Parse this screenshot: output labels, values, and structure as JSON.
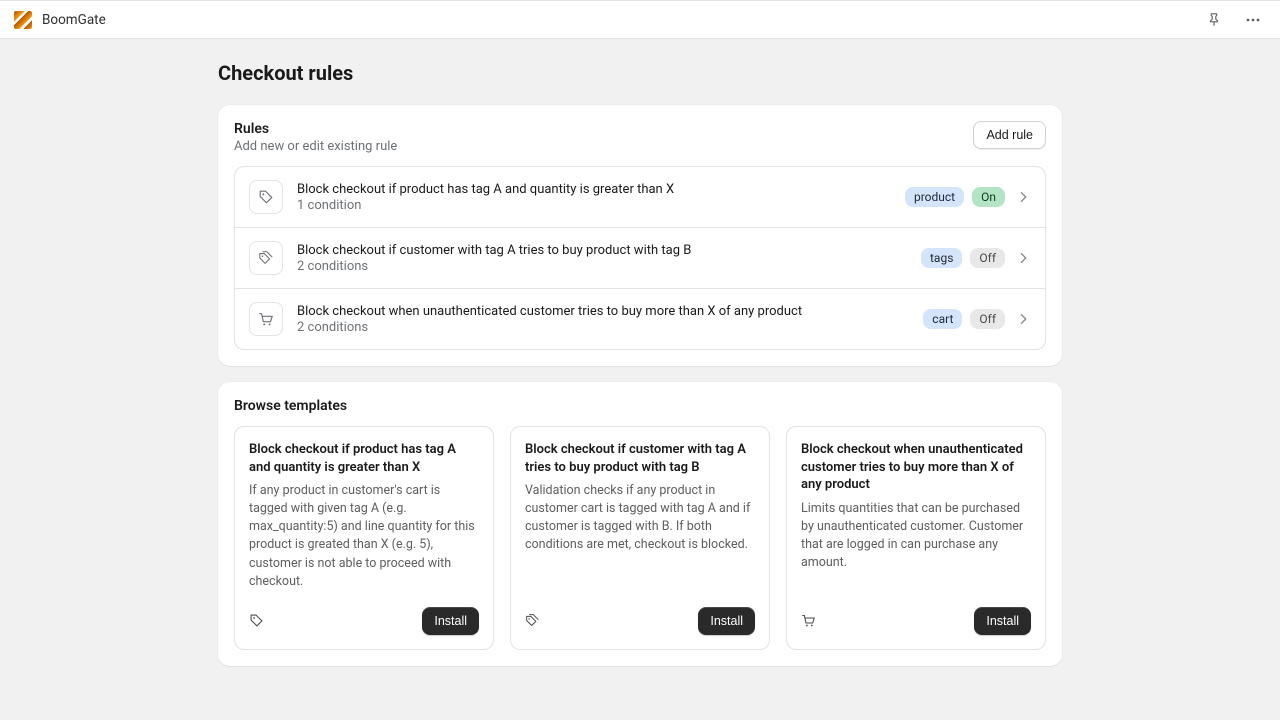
{
  "app": {
    "name": "BoomGate"
  },
  "page": {
    "title": "Checkout rules"
  },
  "rules_section": {
    "title": "Rules",
    "subtitle": "Add new or edit existing rule",
    "add_button": "Add rule",
    "rules": [
      {
        "icon": "tag-icon",
        "title": "Block checkout if product has tag A and quantity is greater than X",
        "meta": "1 condition",
        "type_badge": "product",
        "status_badge": "On",
        "status_on": true
      },
      {
        "icon": "tags-icon",
        "title": "Block checkout if customer with tag A tries to buy product with tag B",
        "meta": "2 conditions",
        "type_badge": "tags",
        "status_badge": "Off",
        "status_on": false
      },
      {
        "icon": "cart-icon",
        "title": "Block checkout when unauthenticated customer tries to buy more than X of any product",
        "meta": "2 conditions",
        "type_badge": "cart",
        "status_badge": "Off",
        "status_on": false
      }
    ]
  },
  "templates_section": {
    "title": "Browse templates",
    "install_label": "Install",
    "templates": [
      {
        "icon": "tag-icon",
        "title": "Block checkout if product has tag A and quantity is greater than X",
        "desc": "If any product in customer's cart is tagged with given tag A (e.g. max_quantity:5) and line quantity for this product is greated than X (e.g. 5), customer is not able to proceed with checkout."
      },
      {
        "icon": "tags-icon",
        "title": "Block checkout if customer with tag A tries to buy product with tag B",
        "desc": "Validation checks if any product in customer cart is tagged with tag A and if customer is tagged with B. If both conditions are met, checkout is blocked."
      },
      {
        "icon": "cart-icon",
        "title": "Block checkout when unauthenticated customer tries to buy more than X of any product",
        "desc": "Limits quantities that can be purchased by unauthenticated customer. Customer that are logged in can purchase any amount."
      }
    ]
  }
}
